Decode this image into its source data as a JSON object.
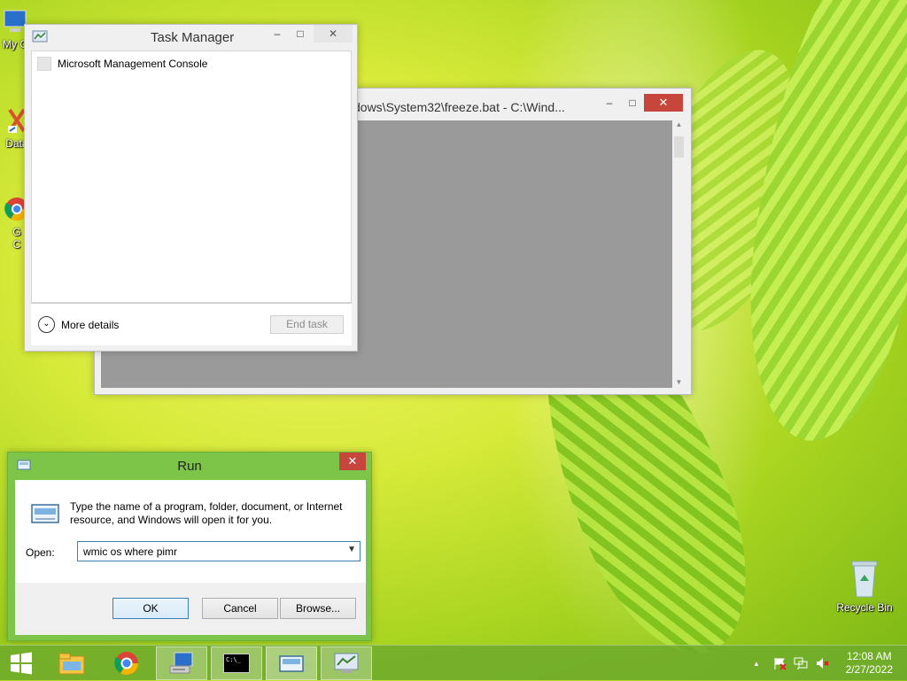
{
  "desktop": {
    "icons": [
      {
        "label": "My C",
        "icon": "computer-icon"
      },
      {
        "label": "Data",
        "icon": "shortcut-icon"
      },
      {
        "label": "G\nC",
        "icon": "chrome-shortcut-icon"
      },
      {
        "label": "Recycle Bin",
        "icon": "recycle-bin-icon"
      }
    ]
  },
  "cmd_window": {
    "title": "dows\\System32\\freeze.bat    - C:\\Wind...",
    "minimize": "–",
    "maximize": "□",
    "close": "✕"
  },
  "task_manager": {
    "title": "Task Manager",
    "minimize": "–",
    "maximize": "□",
    "close": "✕",
    "processes": [
      "Microsoft Management Console"
    ],
    "more_details": "More details",
    "end_task": "End task"
  },
  "run_dialog": {
    "title": "Run",
    "close": "✕",
    "description": "Type the name of a program, folder, document, or Internet resource, and Windows will open it for you.",
    "open_label": "Open:",
    "open_value": "wmic os where pimr",
    "ok": "OK",
    "cancel": "Cancel",
    "browse": "Browse..."
  },
  "taskbar": {
    "apps": [
      "start-icon",
      "file-explorer-icon",
      "chrome-icon",
      "network-computer-icon",
      "command-prompt-icon",
      "run-icon",
      "task-manager-icon"
    ],
    "cmd_label": "C:\\_",
    "tray_arrow": "▲",
    "time": "12:08 AM",
    "date": "2/27/2022"
  },
  "colors": {
    "run_frame": "#7dc548",
    "close_red": "#c7463b",
    "taskbar": "#6eaa2d"
  }
}
